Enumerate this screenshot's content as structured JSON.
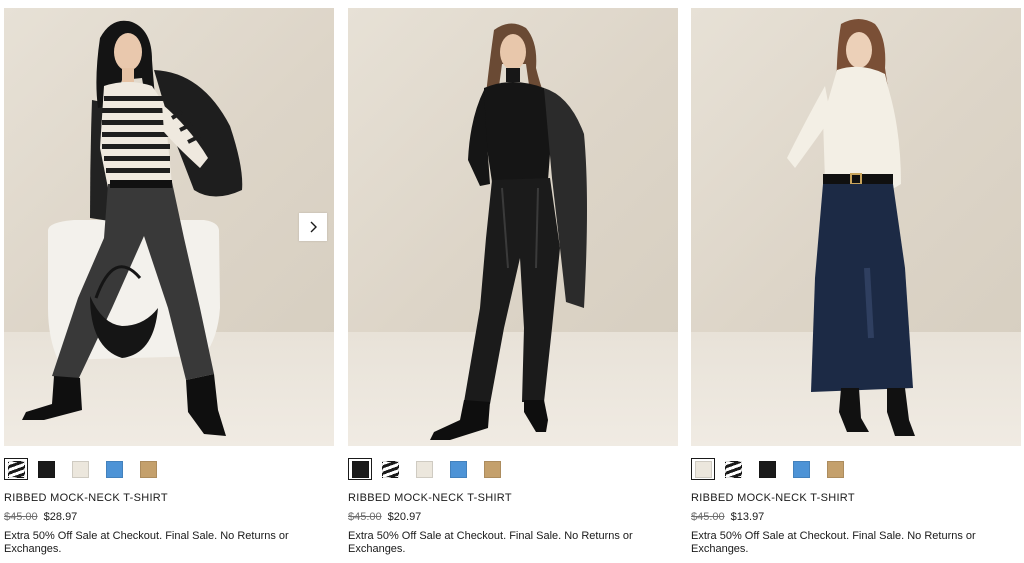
{
  "products": [
    {
      "title": "RIBBED MOCK-NECK T-SHIRT",
      "original_price": "$45.00",
      "sale_price": "$28.97",
      "promo": "Extra 50% Off Sale at Checkout. Final Sale. No Returns or Exchanges.",
      "selected_swatch": 0,
      "has_next_arrow": true,
      "swatches": [
        "stripe",
        "#1a1a1a",
        "#ece7dd",
        "#4d93d6",
        "#c4a06c"
      ]
    },
    {
      "title": "RIBBED MOCK-NECK T-SHIRT",
      "original_price": "$45.00",
      "sale_price": "$20.97",
      "promo": "Extra 50% Off Sale at Checkout. Final Sale. No Returns or Exchanges.",
      "selected_swatch": 0,
      "has_next_arrow": false,
      "swatches": [
        "#1a1a1a",
        "stripe",
        "#ece7dd",
        "#4d93d6",
        "#c4a06c"
      ]
    },
    {
      "title": "RIBBED MOCK-NECK T-SHIRT",
      "original_price": "$45.00",
      "sale_price": "$13.97",
      "promo": "Extra 50% Off Sale at Checkout. Final Sale. No Returns or Exchanges.",
      "selected_swatch": 0,
      "has_next_arrow": false,
      "swatches": [
        "#ece7dd",
        "stripe",
        "#1a1a1a",
        "#4d93d6",
        "#c4a06c"
      ]
    }
  ],
  "icons": {
    "next": "chevron-right-icon"
  }
}
